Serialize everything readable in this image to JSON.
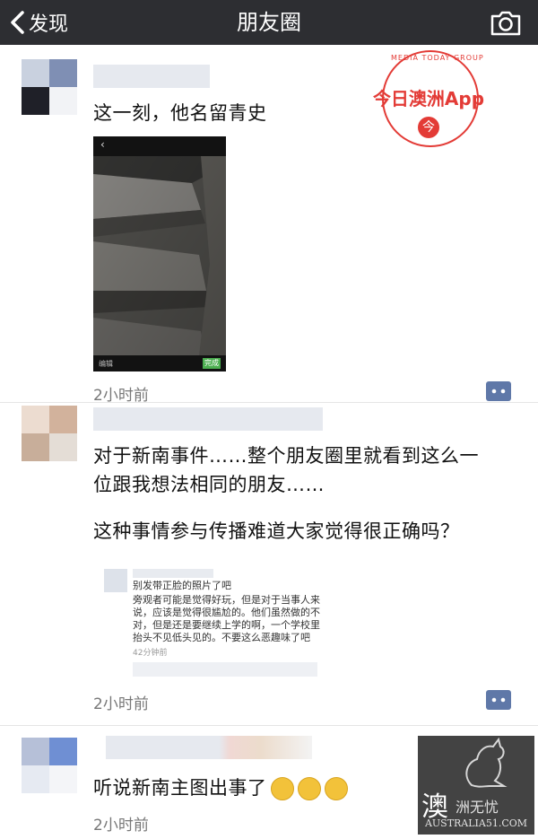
{
  "nav": {
    "back_label": "发现",
    "title": "朋友圈"
  },
  "posts": [
    {
      "text": "这一刻，他名留青史",
      "time": "2小时前",
      "video": {
        "back_glyph": "‹",
        "edit_label": "编辑",
        "done_label": "完成"
      }
    },
    {
      "lines": [
        "对于新南事件……整个朋友圈里就看到这么一",
        "位跟我想法相同的朋友……",
        "这种事情参与传播难道大家觉得很正确吗？"
      ],
      "embed": {
        "lines": [
          "别发带正脸的照片了吧",
          "旁观者可能是觉得好玩，但是对于当事人来",
          "说，应该是觉得很尴尬的。他们虽然做的不",
          "对，但是还是要继续上学的啊，一个学校里",
          "抬头不见低头见的。不要这么恶趣味了吧"
        ],
        "time": "42分钟前"
      },
      "time": "2小时前"
    },
    {
      "text": "听说新南主图出事了",
      "time": "2小时前",
      "emoji_count": 3
    }
  ],
  "watermarks": {
    "stamp_ring": "MEDIA TODAY GROUP",
    "stamp_brand": "今日澳洲App",
    "stamp_icon": "今",
    "corner_big": "澳",
    "corner_small": "洲无忧",
    "corner_domain": "AUSTRALIA51.COM"
  },
  "colors": {
    "nav_bg": "#2d2e32",
    "brand_red": "#e33b36",
    "comment_btn": "#5f78a8"
  }
}
